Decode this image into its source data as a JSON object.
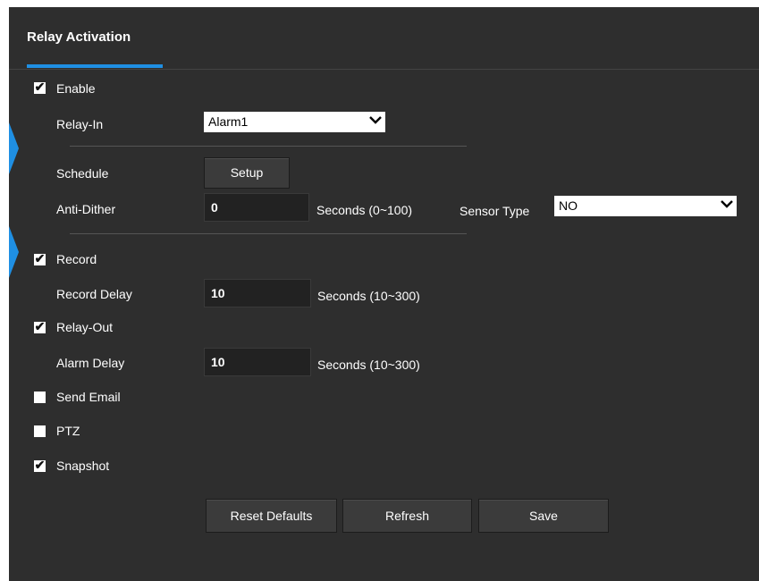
{
  "title": "Relay Activation",
  "enable": {
    "label": "Enable",
    "checked": true
  },
  "relay_in": {
    "label": "Relay-In",
    "value": "Alarm1"
  },
  "schedule": {
    "label": "Schedule",
    "button": "Setup"
  },
  "anti_dither": {
    "label": "Anti-Dither",
    "value": "0",
    "unit": "Seconds (0~100)"
  },
  "sensor_type": {
    "label": "Sensor Type",
    "value": "NO"
  },
  "record": {
    "label": "Record",
    "checked": true
  },
  "record_delay": {
    "label": "Record Delay",
    "value": "10",
    "unit": "Seconds (10~300)"
  },
  "relay_out": {
    "label": "Relay-Out",
    "checked": true
  },
  "alarm_delay": {
    "label": "Alarm Delay",
    "value": "10",
    "unit": "Seconds (10~300)"
  },
  "send_email": {
    "label": "Send Email",
    "checked": false
  },
  "ptz": {
    "label": "PTZ",
    "checked": false
  },
  "snapshot": {
    "label": "Snapshot",
    "checked": true
  },
  "buttons": {
    "reset": "Reset Defaults",
    "refresh": "Refresh",
    "save": "Save"
  },
  "tick_glyph": "✔",
  "accent_color": "#1f8fe3"
}
